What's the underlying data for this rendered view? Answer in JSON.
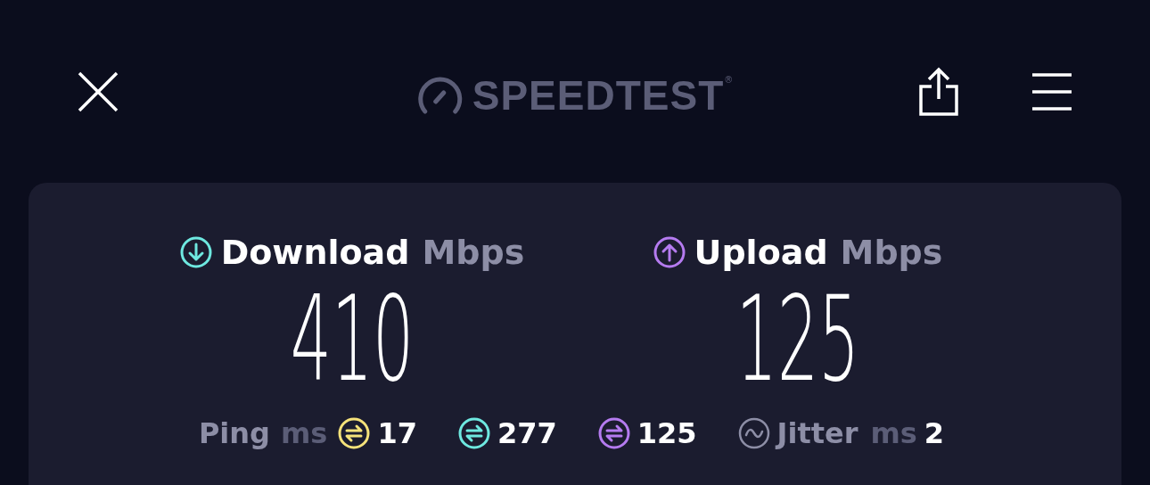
{
  "header": {
    "logo": "SPEEDTEST",
    "trademark": "®"
  },
  "results": [
    {
      "kind": "download",
      "label": "Download",
      "unit": "Mbps",
      "value": "410",
      "color": "#6ee8e0"
    },
    {
      "kind": "upload",
      "label": "Upload",
      "unit": "Mbps",
      "value": "125",
      "color": "#b57bf0"
    }
  ],
  "ping": {
    "label": "Ping",
    "unit": "ms",
    "readings": [
      {
        "value": "17",
        "color": "#f5e27a"
      },
      {
        "value": "277",
        "color": "#6ee8e0"
      },
      {
        "value": "125",
        "color": "#b57bf0"
      }
    ]
  },
  "jitter": {
    "label": "Jitter",
    "unit": "ms",
    "value": "2"
  }
}
